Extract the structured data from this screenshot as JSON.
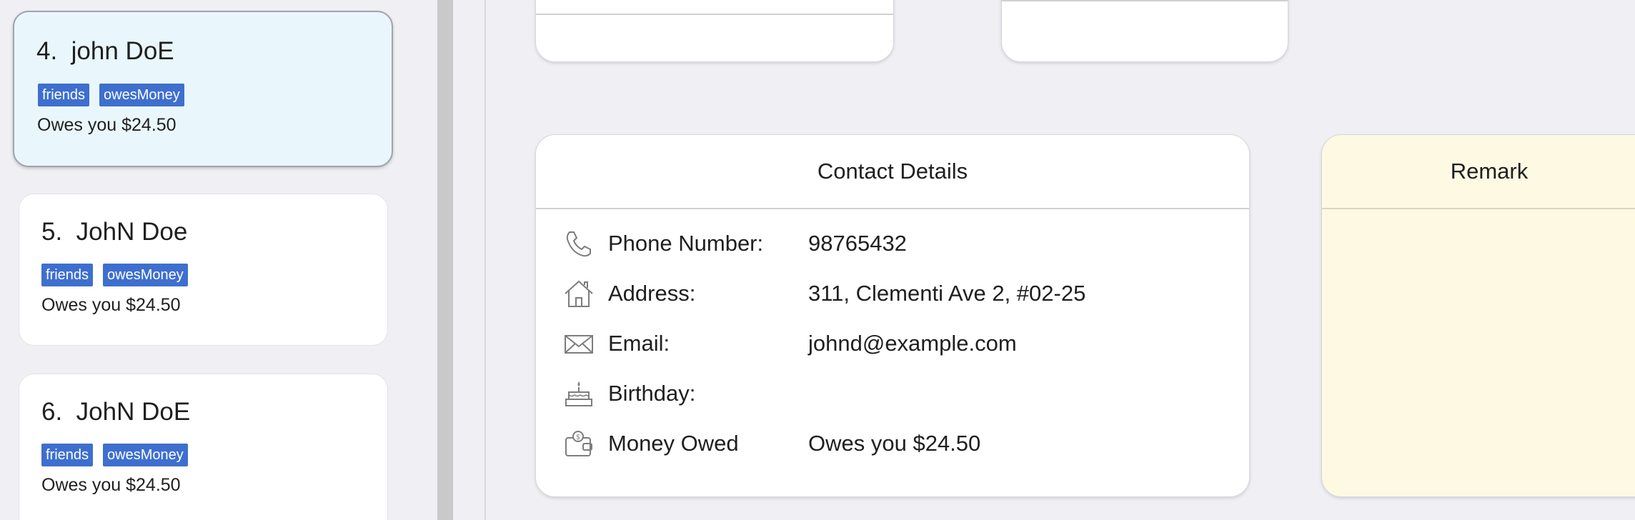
{
  "contacts": [
    {
      "index": "4.",
      "name": "john DoE",
      "tags": [
        "friends",
        "owesMoney"
      ],
      "owes": "Owes you $24.50",
      "selected": true
    },
    {
      "index": "5.",
      "name": "JohN Doe",
      "tags": [
        "friends",
        "owesMoney"
      ],
      "owes": "Owes you $24.50",
      "selected": false
    },
    {
      "index": "6.",
      "name": "JohN DoE",
      "tags": [
        "friends",
        "owesMoney"
      ],
      "owes": "Owes you $24.50",
      "selected": false
    }
  ],
  "contact_details": {
    "title": "Contact Details",
    "rows": [
      {
        "icon": "phone-icon",
        "label": "Phone Number:",
        "value": "98765432"
      },
      {
        "icon": "house-icon",
        "label": "Address:",
        "value": "311, Clementi Ave 2, #02-25"
      },
      {
        "icon": "envelope-icon",
        "label": "Email:",
        "value": "johnd@example.com"
      },
      {
        "icon": "cake-icon",
        "label": "Birthday:",
        "value": ""
      },
      {
        "icon": "wallet-icon",
        "label": "Money Owed",
        "value": "Owes you $24.50"
      }
    ]
  },
  "remark": {
    "title": "Remark"
  },
  "colors": {
    "tag_bg": "#3e6fcf",
    "selected_card_bg": "#e9f7fd",
    "remark_bg": "#fdf9e3",
    "page_bg": "#efeff4"
  }
}
